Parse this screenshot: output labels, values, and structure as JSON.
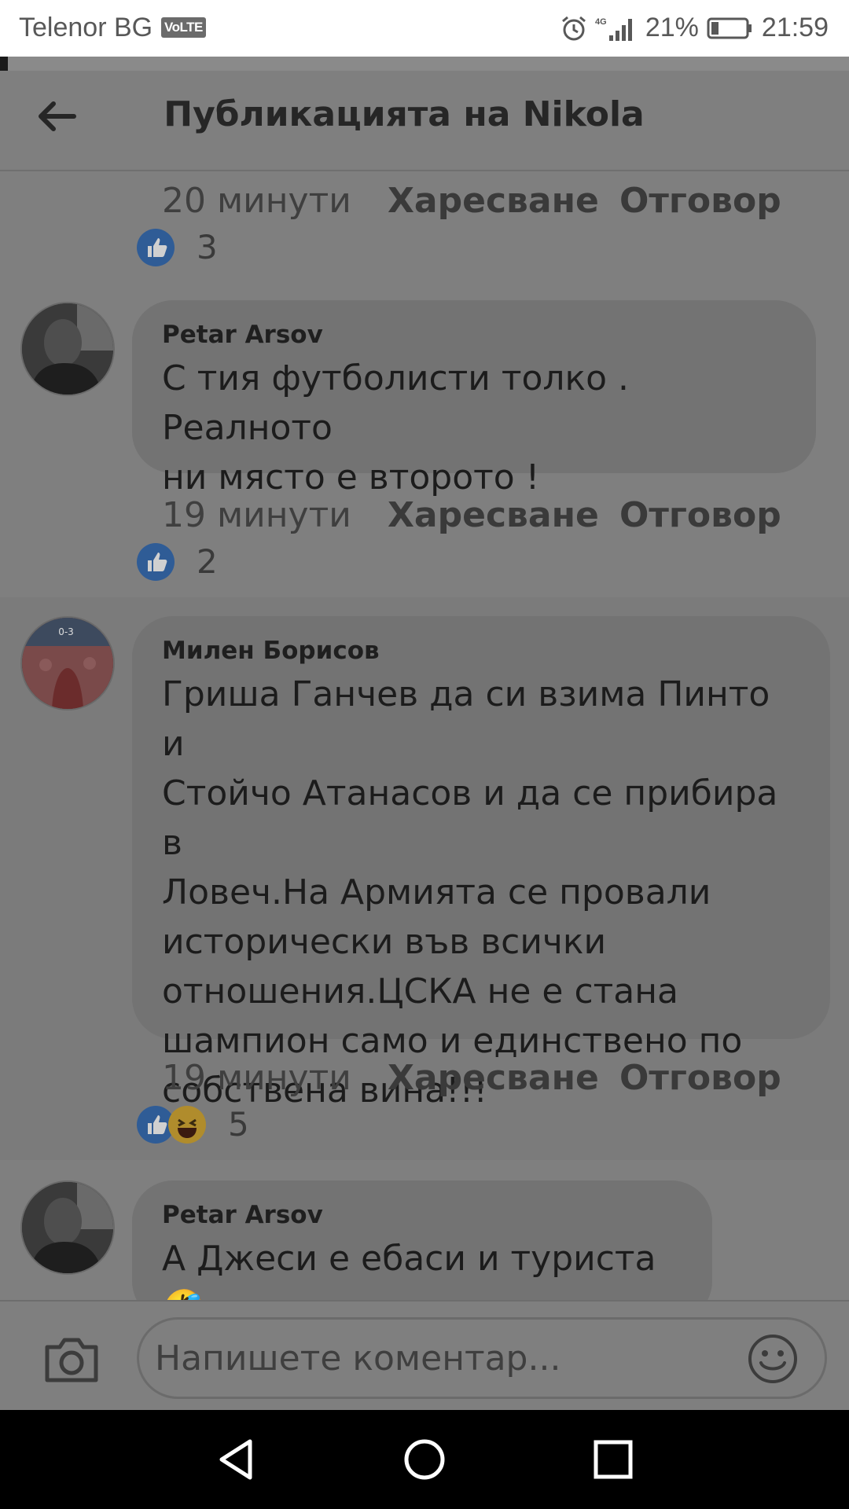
{
  "status_bar": {
    "carrier": "Telenor BG",
    "volte": "VoLTE",
    "network": "4G",
    "battery": "21%",
    "battery_level": 0.21,
    "time": "21:59"
  },
  "header": {
    "title": "Публикацията на Nikola"
  },
  "top_meta": {
    "time": "20 минути",
    "like_label": "Харесване",
    "reply_label": "Отговор",
    "reaction_count": "3"
  },
  "comments": [
    {
      "author": "Petar Arsov",
      "text": "С тия футболисти толко . Реалното\nни място е второто !",
      "time": "19 минути",
      "like_label": "Харесване",
      "reply_label": "Отговор",
      "reaction_count": "2"
    },
    {
      "author": "Милен Борисов",
      "text": "Гриша Ганчев да си взима Пинто и\nСтойчо Атанасов  и да се прибира в\nЛовеч.На Армията се провали\nисторически във всички\nотношения.ЦСКА не е стана\nшампион само и единствено по\nсобствена вина!!!",
      "avatar_score": "0-3",
      "time": "19 минути",
      "like_label": "Харесване",
      "reply_label": "Отговор",
      "reaction_count": "5"
    },
    {
      "author": "Petar Arsov",
      "text": "А Джеси е ебаси и туриста 🤣"
    }
  ],
  "composer": {
    "placeholder": "Напишете коментар..."
  },
  "icons": {
    "back": "arrow-left-icon",
    "camera": "camera-icon",
    "emoji": "smiley-icon",
    "like_reaction": "thumbs-up-icon",
    "haha_reaction": "laughing-face-icon"
  }
}
